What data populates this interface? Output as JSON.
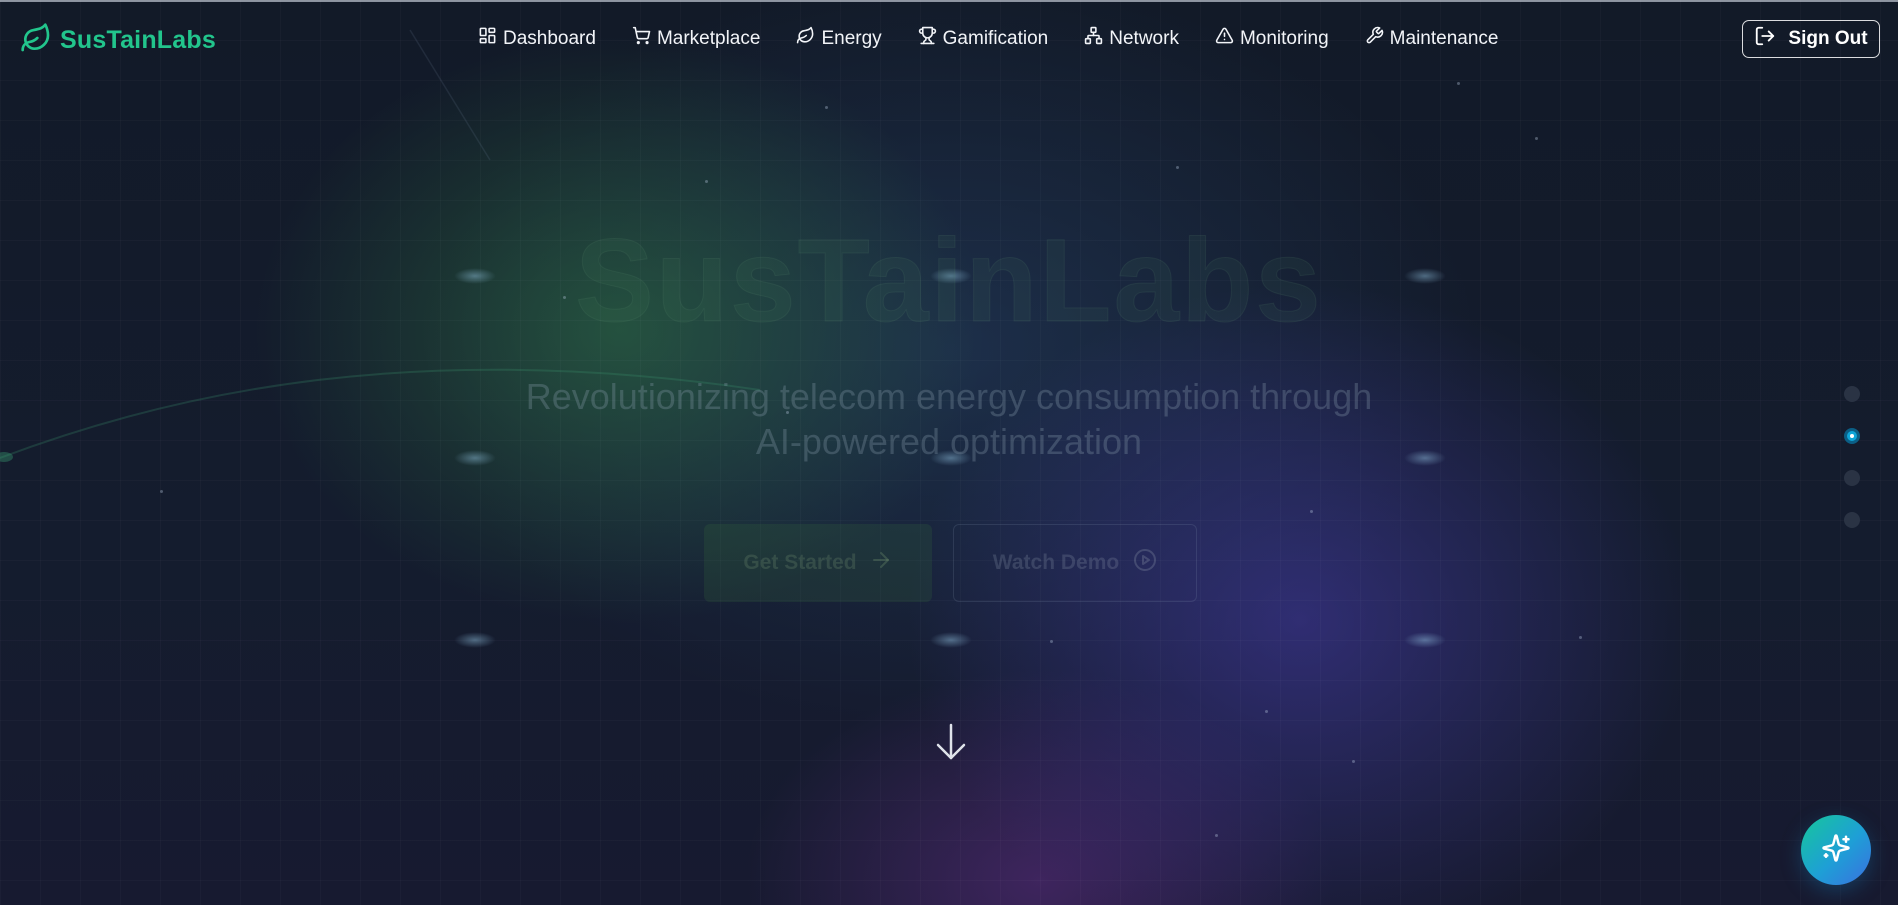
{
  "brand": {
    "name": "SusTainLabs",
    "icon": "leaf-icon",
    "color": "#22c58c"
  },
  "nav": {
    "items": [
      {
        "label": "Dashboard",
        "icon": "grid-icon"
      },
      {
        "label": "Marketplace",
        "icon": "cart-icon"
      },
      {
        "label": "Energy",
        "icon": "leaf-icon"
      },
      {
        "label": "Gamification",
        "icon": "trophy-icon"
      },
      {
        "label": "Network",
        "icon": "network-icon"
      },
      {
        "label": "Monitoring",
        "icon": "alert-triangle-icon"
      },
      {
        "label": "Maintenance",
        "icon": "wrench-icon"
      }
    ],
    "sign_out": "Sign Out"
  },
  "hero": {
    "title": "SusTainLabs",
    "subtitle_line1": "Revolutionizing telecom energy consumption through",
    "subtitle_line2": "AI-powered optimization",
    "primary_button": "Get Started",
    "secondary_button": "Watch Demo"
  },
  "section_dots": {
    "count": 4,
    "active_index": 1,
    "active_color": "#0ea5d8"
  },
  "fab": {
    "icon": "sparkles-icon"
  }
}
